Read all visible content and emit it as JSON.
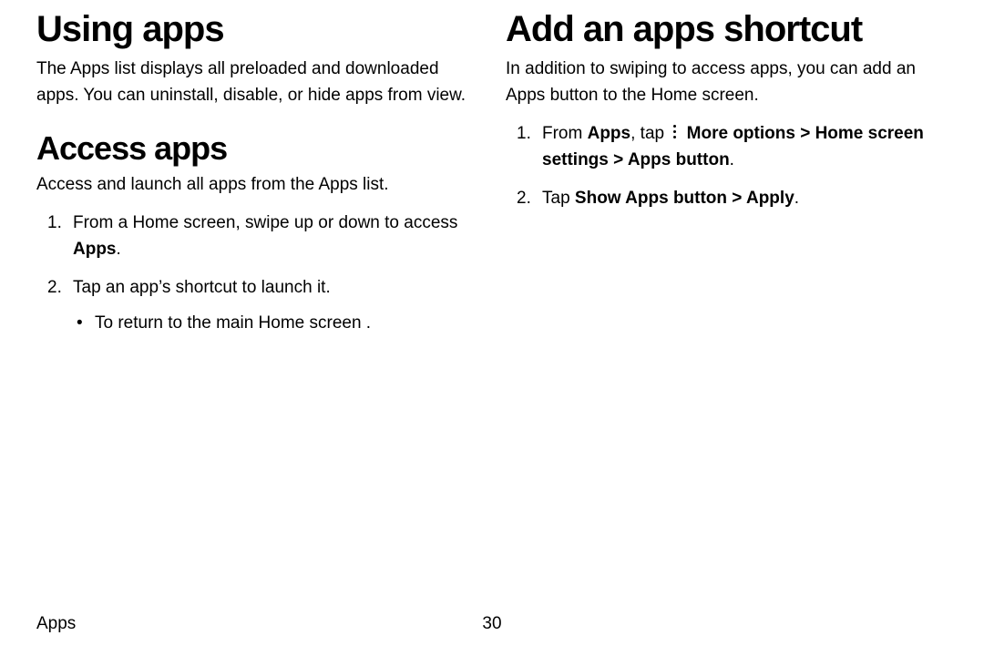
{
  "left": {
    "h1": "Using apps",
    "intro": "The Apps list displays all preloaded and downloaded apps. You can uninstall, disable, or hide apps from view.",
    "h2": "Access apps",
    "sub_intro": "Access and launch all apps from the Apps list.",
    "step1_pre": "From a Home screen, swipe up or down to access ",
    "step1_bold": "Apps",
    "step1_post": ".",
    "step2": "Tap an app’s shortcut to launch it.",
    "bullet1": "To return to the main Home screen ."
  },
  "right": {
    "h1": "Add an apps shortcut",
    "intro": "In addition to swiping to access apps, you can add an Apps button to the Home screen.",
    "r1_pre": "From ",
    "r1_b1": "Apps",
    "r1_mid1": ", tap ",
    "r1_b2": "More options",
    "r1_gt1": " > ",
    "r1_b3": "Home screen settings",
    "r1_gt2": " > ",
    "r1_b4": "Apps button",
    "r1_post": ".",
    "r2_pre": "Tap ",
    "r2_b1": "Show Apps button",
    "r2_gt": " > ",
    "r2_b2": "Apply",
    "r2_post": "."
  },
  "footer": {
    "section": "Apps",
    "page": "30"
  }
}
